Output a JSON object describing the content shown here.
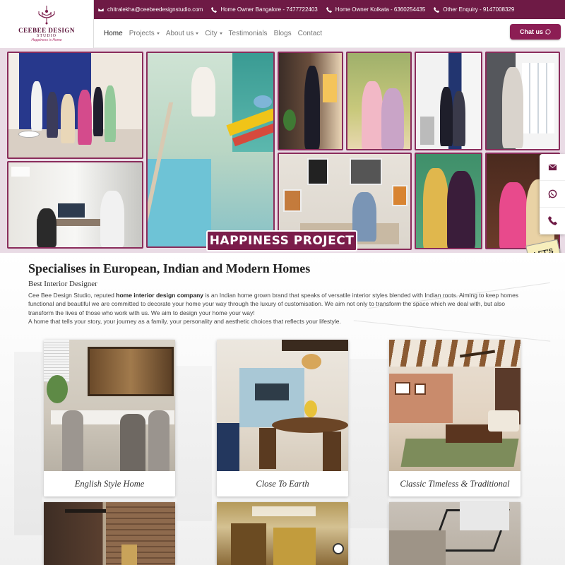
{
  "logo": {
    "name": "CEEBEE DESIGN",
    "studio": "STUDIO",
    "tagline": "Happiness is Home"
  },
  "topbar": [
    {
      "icon": "mail-icon",
      "text": "chitralekha@ceebeedesignstudio.com"
    },
    {
      "icon": "phone-icon",
      "text": "Home Owner Bangalore - 7477722403"
    },
    {
      "icon": "phone-icon",
      "text": "Home Owner Kolkata - 6360254435"
    },
    {
      "icon": "phone-icon",
      "text": "Other Enquiry - 9147008329"
    }
  ],
  "nav": {
    "home": "Home",
    "projects": "Projects",
    "about": "About us",
    "city": "City",
    "testimonials": "Testimonials",
    "blogs": "Blogs",
    "contact": "Contact",
    "chat": "Chat us"
  },
  "banner": {
    "label": "HAPPINESS PROJECT"
  },
  "side": {
    "lets_talk": "LET'S TALK!"
  },
  "intro": {
    "title": "Specialises in European, Indian and Modern Homes",
    "subtitle": "Best Interior Designer",
    "p1_before": "Cee Bee Design Studio, reputed ",
    "p1_bold": "home interior design company",
    "p1_after": " is an Indian home grown brand that speaks of versatile interior styles blended with Indian roots. Aiming to keep homes functional and beautiful we are committed to decorate your home your way through the luxury of customisation. We aim not only to transform the space which we deal with, but also transform the lives of those who work with us. We aim to design your home your way!",
    "p2": "A home that tells your story, your journey as a family, your personality and aesthetic choices that reflects your lifestyle."
  },
  "cards": [
    {
      "label": "English Style Home"
    },
    {
      "label": "Close To Earth"
    },
    {
      "label": "Classic Timeless & Traditional"
    }
  ],
  "colors": {
    "brand": "#6e1a45",
    "accent": "#8c1e54",
    "chat": "#f0711e"
  }
}
